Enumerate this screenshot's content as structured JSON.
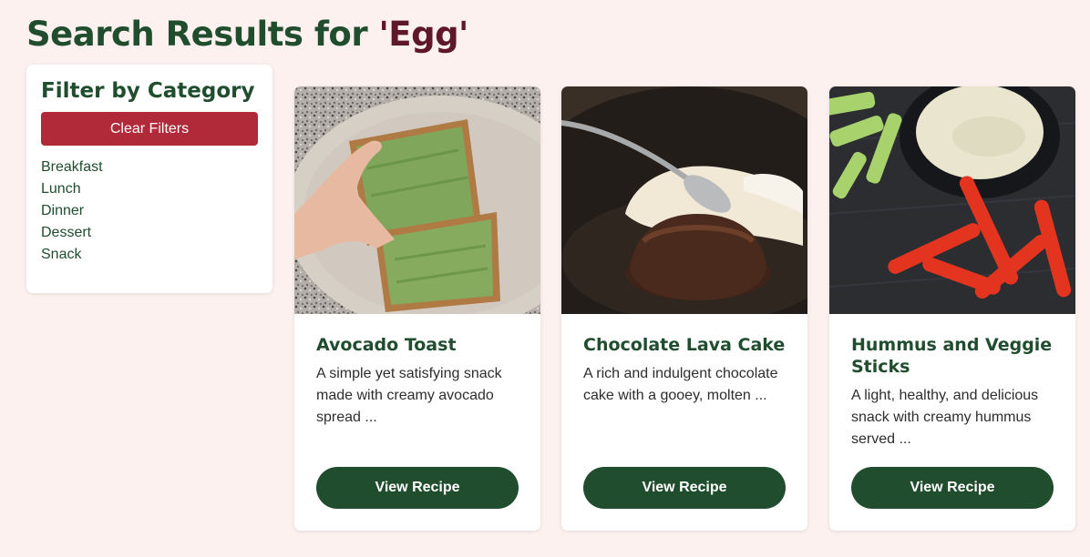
{
  "header": {
    "title_prefix": "Search Results for ",
    "query": "'Egg'"
  },
  "sidebar": {
    "heading": "Filter by Category",
    "clear_label": "Clear Filters",
    "categories": [
      "Breakfast",
      "Lunch",
      "Dinner",
      "Dessert",
      "Snack"
    ]
  },
  "results": [
    {
      "title": "Avocado Toast",
      "description": "A simple yet satisfying snack made with creamy avocado spread ...",
      "button_label": "View Recipe",
      "image": "avocado-toast-photo"
    },
    {
      "title": "Chocolate Lava Cake",
      "description": "A rich and indulgent chocolate cake with a gooey, molten ...",
      "button_label": "View Recipe",
      "image": "chocolate-lava-cake-photo"
    },
    {
      "title": "Hummus and Veggie Sticks",
      "description": "A light, healthy, and delicious snack with creamy hummus served ...",
      "button_label": "View Recipe",
      "image": "hummus-veggie-sticks-photo"
    }
  ],
  "colors": {
    "background": "#fcf1ee",
    "primary_green": "#1f4d2e",
    "query_maroon": "#5e1828",
    "clear_red": "#b12a3a"
  }
}
